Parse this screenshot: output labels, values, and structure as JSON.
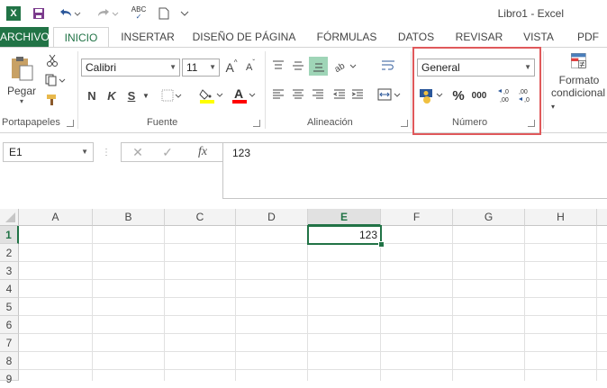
{
  "titlebar": {
    "title": "Libro1 - Excel",
    "excel_logo": "X",
    "save_icon": "save-icon",
    "undo_icon": "undo-icon",
    "redo_icon": "redo-icon",
    "spelling_label": "ABC",
    "new_icon": "new-document-icon",
    "customize_icon": "chevron-down-icon"
  },
  "tabs": [
    "ARCHIVO",
    "INICIO",
    "INSERTAR",
    "DISEÑO DE PÁGINA",
    "FÓRMULAS",
    "DATOS",
    "REVISAR",
    "VISTA",
    "PDF"
  ],
  "ribbon": {
    "portapapeles": {
      "label": "Portapapeles",
      "paste_label": "Pegar"
    },
    "fuente": {
      "label": "Fuente",
      "font_name": "Calibri",
      "font_size": "11",
      "grow": "A",
      "shrink": "A",
      "bold": "N",
      "italic": "K",
      "underline": "S",
      "fill_color": "#ffff00",
      "font_color": "#ff0000"
    },
    "alineacion": {
      "label": "Alineación"
    },
    "numero": {
      "label": "Número",
      "format": "General",
      "percent": "%",
      "thousands": "000",
      "inc_dec": ",0 ,00",
      "dec_dec": ",00 ,0"
    },
    "estilos": {
      "cond_format_line1": "Formato",
      "cond_format_line2": "condicional"
    }
  },
  "formula_bar": {
    "name_box": "E1",
    "fx": "fx",
    "value": "123"
  },
  "grid": {
    "columns": [
      "A",
      "B",
      "C",
      "D",
      "E",
      "F",
      "G",
      "H"
    ],
    "rows": [
      "1",
      "2",
      "3",
      "4",
      "5",
      "6",
      "7",
      "8",
      "9"
    ],
    "selected_cell": "E1",
    "cell_e1": "123"
  },
  "colors": {
    "accent": "#217346",
    "highlight": "#e0595b"
  }
}
